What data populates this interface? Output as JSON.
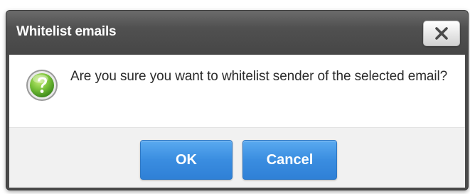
{
  "dialog": {
    "title": "Whitelist emails",
    "close_icon": "close-icon",
    "message_icon": "question-help-icon",
    "message": "Are you sure you want to whitelist sender of the selected email?",
    "buttons": {
      "ok_label": "OK",
      "cancel_label": "Cancel"
    }
  },
  "colors": {
    "titlebar": "#4a4a4a",
    "button_primary": "#3a8de0",
    "icon_green": "#5fae2e"
  }
}
